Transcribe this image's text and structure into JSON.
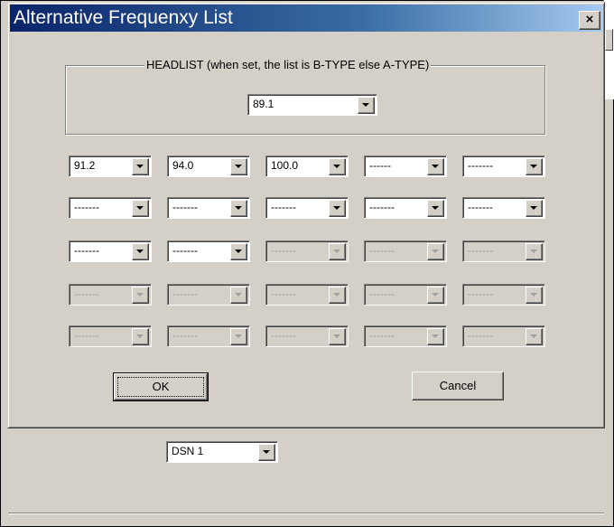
{
  "dialog": {
    "title": "Alternative Frequenxy List",
    "close_label": "×",
    "group_label": "HEADLIST (when set, the list is B-TYPE else A-TYPE)",
    "headlist_value": "89.1",
    "grid": [
      [
        "91.2",
        "94.0",
        "100.0",
        "------",
        "-------"
      ],
      [
        "-------",
        "-------",
        "-------",
        "-------",
        "-------"
      ],
      [
        "-------",
        "-------",
        "-------",
        "-------",
        "-------"
      ],
      [
        "-------",
        "-------",
        "-------",
        "-------",
        "-------"
      ],
      [
        "-------",
        "-------",
        "-------",
        "-------",
        "-------"
      ]
    ],
    "ok_label": "OK",
    "cancel_label": "Cancel"
  },
  "parent": {
    "dsn_value": "DSN 1"
  }
}
